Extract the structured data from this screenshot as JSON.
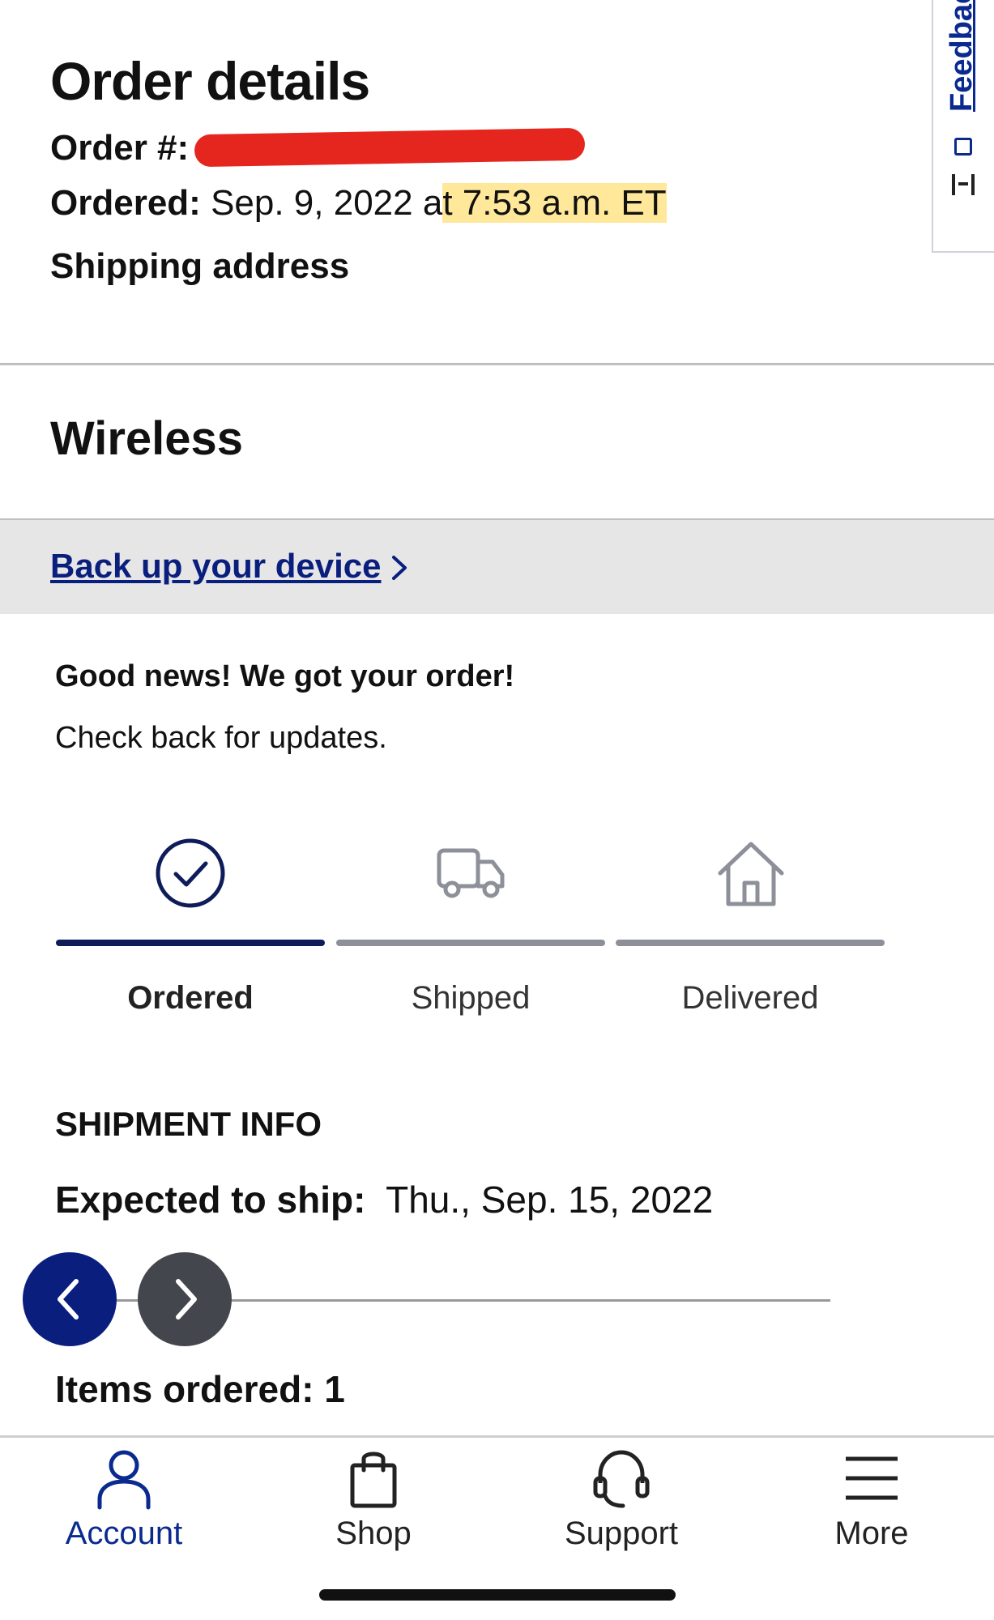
{
  "header": {
    "title": "Order details",
    "order_label": "Order #:",
    "ordered_label": "Ordered:",
    "ordered_date": "Sep. 9, 2022 a",
    "ordered_time": "t 7:53 a.m. ET",
    "shipping_label": "Shipping address"
  },
  "feedback": {
    "label": "Feedback"
  },
  "section": {
    "title": "Wireless"
  },
  "backup": {
    "link": "Back up your device"
  },
  "status": {
    "headline": "Good news! We got your order!",
    "subtext": "Check back for updates."
  },
  "tracker": {
    "progress_active_index": 0,
    "steps": [
      {
        "label": "Ordered",
        "icon": "check-circle-icon",
        "active": true
      },
      {
        "label": "Shipped",
        "icon": "truck-icon",
        "active": false
      },
      {
        "label": "Delivered",
        "icon": "house-icon",
        "active": false
      }
    ]
  },
  "shipment": {
    "title": "SHIPMENT INFO",
    "expected_label": "Expected to ship:",
    "expected_value": "Thu., Sep. 15, 2022"
  },
  "items": {
    "label": "Items ordered: 1"
  },
  "bottom_nav": [
    {
      "label": "Account",
      "icon": "person-icon",
      "active": true
    },
    {
      "label": "Shop",
      "icon": "bag-icon",
      "active": false
    },
    {
      "label": "Support",
      "icon": "headset-icon",
      "active": false
    },
    {
      "label": "More",
      "icon": "menu-icon",
      "active": false
    }
  ],
  "colors": {
    "accent": "#0a1e7d",
    "active_bar": "#0e1c5a",
    "inactive_bar": "#8e9099",
    "redaction": "#e5261e",
    "highlight": "#ffd646"
  }
}
